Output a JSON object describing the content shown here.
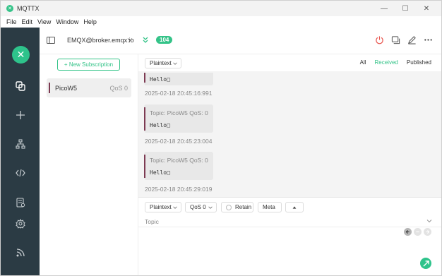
{
  "window": {
    "title": "MQTTX",
    "controls": {
      "minimize": "—",
      "maximize": "☐",
      "close": "✕"
    }
  },
  "menu": [
    "File",
    "Edit",
    "View",
    "Window",
    "Help"
  ],
  "toolbar": {
    "connection_name": "EMQX@broker.emqx.io",
    "message_count": "104"
  },
  "subscriptions": {
    "new_button_label": "+ New Subscription",
    "items": [
      {
        "topic": "PicoW5",
        "qos": "QoS 0",
        "color": "#7d3a52"
      }
    ]
  },
  "messages": {
    "format": "Plaintext",
    "filters": [
      "All",
      "Received",
      "Published"
    ],
    "active_filter": "Received",
    "items": [
      {
        "meta": "",
        "payload": "Hello□",
        "time": "2025-02-18 20:45:16:991"
      },
      {
        "meta": "Topic: PicoW5    QoS: 0",
        "payload": "Hello□",
        "time": "2025-02-18 20:45:23:004"
      },
      {
        "meta": "Topic: PicoW5    QoS: 0",
        "payload": "Hello□",
        "time": "2025-02-18 20:45:29:019"
      }
    ]
  },
  "publish": {
    "format": "Plaintext",
    "qos": "QoS 0",
    "retain_label": "Retain",
    "meta_label": "Meta",
    "topic_placeholder": "Topic"
  },
  "colors": {
    "accent": "#34c388",
    "nav_bg": "#2b3b44",
    "topic_bar": "#7d3a52"
  }
}
